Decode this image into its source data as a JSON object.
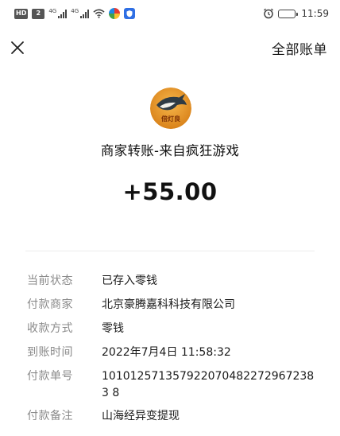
{
  "status_bar": {
    "chip1": "HD",
    "chip2": "2",
    "signal1": "4G",
    "signal2": "4G",
    "time": "11:59",
    "icons": [
      "hd-icon",
      "signal-icon",
      "signal-icon",
      "wifi-icon",
      "app-icon",
      "app-icon",
      "alarm-icon",
      "battery-icon"
    ]
  },
  "nav": {
    "close_icon": "close-icon",
    "all_bills_label": "全部账单"
  },
  "header": {
    "avatar_text": "倍灯良",
    "title": "商家转账-来自疯狂游戏",
    "amount": "+55.00"
  },
  "details": [
    {
      "key": "当前状态",
      "value": "已存入零钱"
    },
    {
      "key": "付款商家",
      "value": "北京豪腾嘉科科技有限公司"
    },
    {
      "key": "收款方式",
      "value": "零钱"
    },
    {
      "key": "到账时间",
      "value": "2022年7月4日 11:58:32"
    },
    {
      "key": "付款单号",
      "value": "1010125713579220704822729672383 8"
    },
    {
      "key": "付款备注",
      "value": "山海经异变提现"
    }
  ],
  "colors": {
    "background": "#ffffff",
    "label_gray": "#8a8a8a",
    "text_dark": "#1a1a1a",
    "avatar_orange": "#e8941a"
  }
}
